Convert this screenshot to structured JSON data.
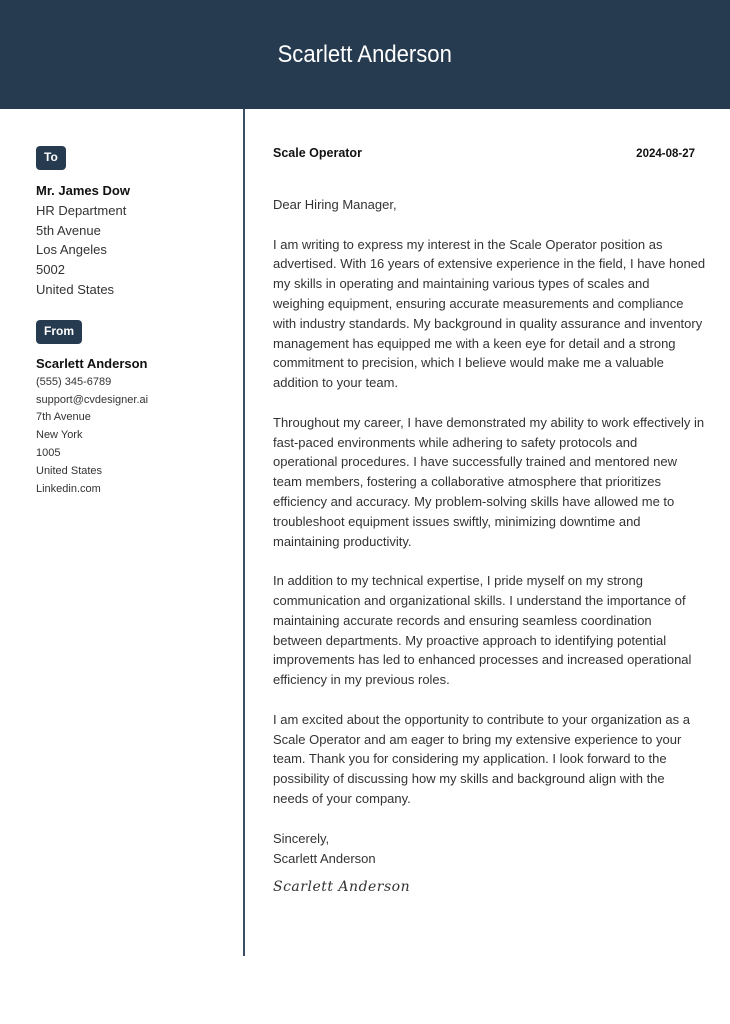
{
  "header": {
    "name": "Scarlett Anderson",
    "background_color": "#273b50"
  },
  "sidebar": {
    "to_label": "To",
    "recipient": {
      "name": "Mr. James Dow",
      "department": "HR Department",
      "street": "5th Avenue",
      "city": "Los Angeles",
      "zip": "5002",
      "country": "United States"
    },
    "from_label": "From",
    "sender": {
      "name": "Scarlett Anderson",
      "phone": "(555) 345-6789",
      "email": "support@cvdesigner.ai",
      "street": "7th Avenue",
      "city": "New York",
      "zip": "1005",
      "country": "United States",
      "website": "Linkedin.com"
    }
  },
  "letter": {
    "job_title": "Scale Operator",
    "date": "2024-08-27",
    "greeting": "Dear Hiring Manager,",
    "paragraphs": [
      {
        "lines": [
          "I am writing to express my interest in the Scale Operator position as",
          "advertised. With 16 years of extensive experience in the field, I have honed",
          "my skills in operating and maintaining various types of scales and",
          "weighing equipment, ensuring accurate measurements and compliance",
          "with industry standards. My background in quality assurance and inventory",
          "management has equipped me with a keen eye for detail and a strong",
          "commitment to precision, which I believe would make me a valuable",
          "addition to your team."
        ]
      },
      {
        "lines": [
          "Throughout my career, I have demonstrated my ability to work effectively in",
          "fast-paced environments while adhering to safety protocols and",
          "operational procedures. I have successfully trained and mentored new",
          "team members, fostering a collaborative atmosphere that prioritizes",
          "efficiency and accuracy. My problem-solving skills have allowed me to",
          "troubleshoot equipment issues swiftly, minimizing downtime and",
          "maintaining productivity."
        ]
      },
      {
        "lines": [
          "In addition to my technical expertise, I pride myself on my strong",
          "communication and organizational skills. I understand the importance of",
          "maintaining accurate records and ensuring seamless coordination",
          "between departments. My proactive approach to identifying potential",
          "improvements has led to enhanced processes and increased operational",
          "efficiency in my previous roles."
        ]
      },
      {
        "lines": [
          "I am excited about the opportunity to contribute to your organization as a",
          "Scale Operator and am eager to bring my extensive experience to your",
          "team. Thank you for considering my application. I look forward to the",
          "possibility of discussing how my skills and background align with the",
          "needs of your company."
        ]
      }
    ],
    "closing": "Sincerely,",
    "closing_name": "Scarlett Anderson",
    "signature": "Scarlett Anderson"
  }
}
